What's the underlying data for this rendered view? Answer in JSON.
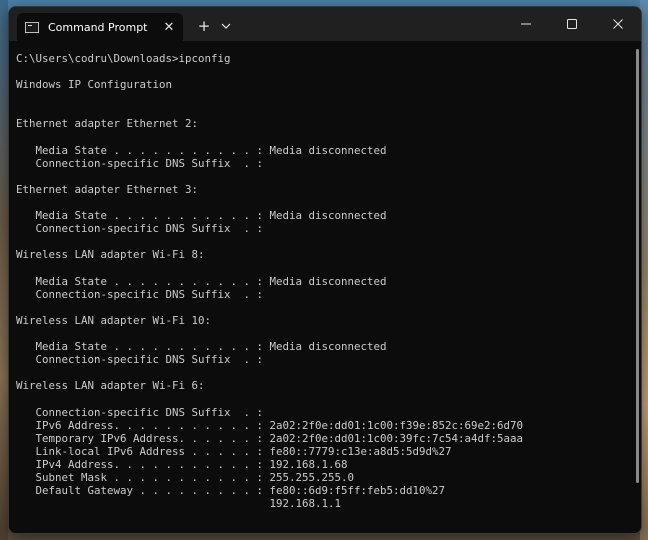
{
  "window": {
    "tab_title": "Command Prompt",
    "tab_close": "✕",
    "new_tab": "+",
    "minimize": "—",
    "maximize": "☐",
    "close": "✕"
  },
  "terminal": {
    "lines": [
      "C:\\Users\\codru\\Downloads>ipconfig",
      "",
      "Windows IP Configuration",
      "",
      "",
      "Ethernet adapter Ethernet 2:",
      "",
      "   Media State . . . . . . . . . . . : Media disconnected",
      "   Connection-specific DNS Suffix  . :",
      "",
      "Ethernet adapter Ethernet 3:",
      "",
      "   Media State . . . . . . . . . . . : Media disconnected",
      "   Connection-specific DNS Suffix  . :",
      "",
      "Wireless LAN adapter Wi-Fi 8:",
      "",
      "   Media State . . . . . . . . . . . : Media disconnected",
      "   Connection-specific DNS Suffix  . :",
      "",
      "Wireless LAN adapter Wi-Fi 10:",
      "",
      "   Media State . . . . . . . . . . . : Media disconnected",
      "   Connection-specific DNS Suffix  . :",
      "",
      "Wireless LAN adapter Wi-Fi 6:",
      "",
      "   Connection-specific DNS Suffix  . :",
      "   IPv6 Address. . . . . . . . . . . : 2a02:2f0e:dd01:1c00:f39e:852c:69e2:6d70",
      "   Temporary IPv6 Address. . . . . . : 2a02:2f0e:dd01:1c00:39fc:7c54:a4df:5aaa",
      "   Link-local IPv6 Address . . . . . : fe80::7779:c13e:a8d5:5d9d%27",
      "   IPv4 Address. . . . . . . . . . . : 192.168.1.68",
      "   Subnet Mask . . . . . . . . . . . : 255.255.255.0",
      "   Default Gateway . . . . . . . . . : fe80::6d9:f5ff:feb5:dd10%27",
      "                                       192.168.1.1"
    ]
  }
}
